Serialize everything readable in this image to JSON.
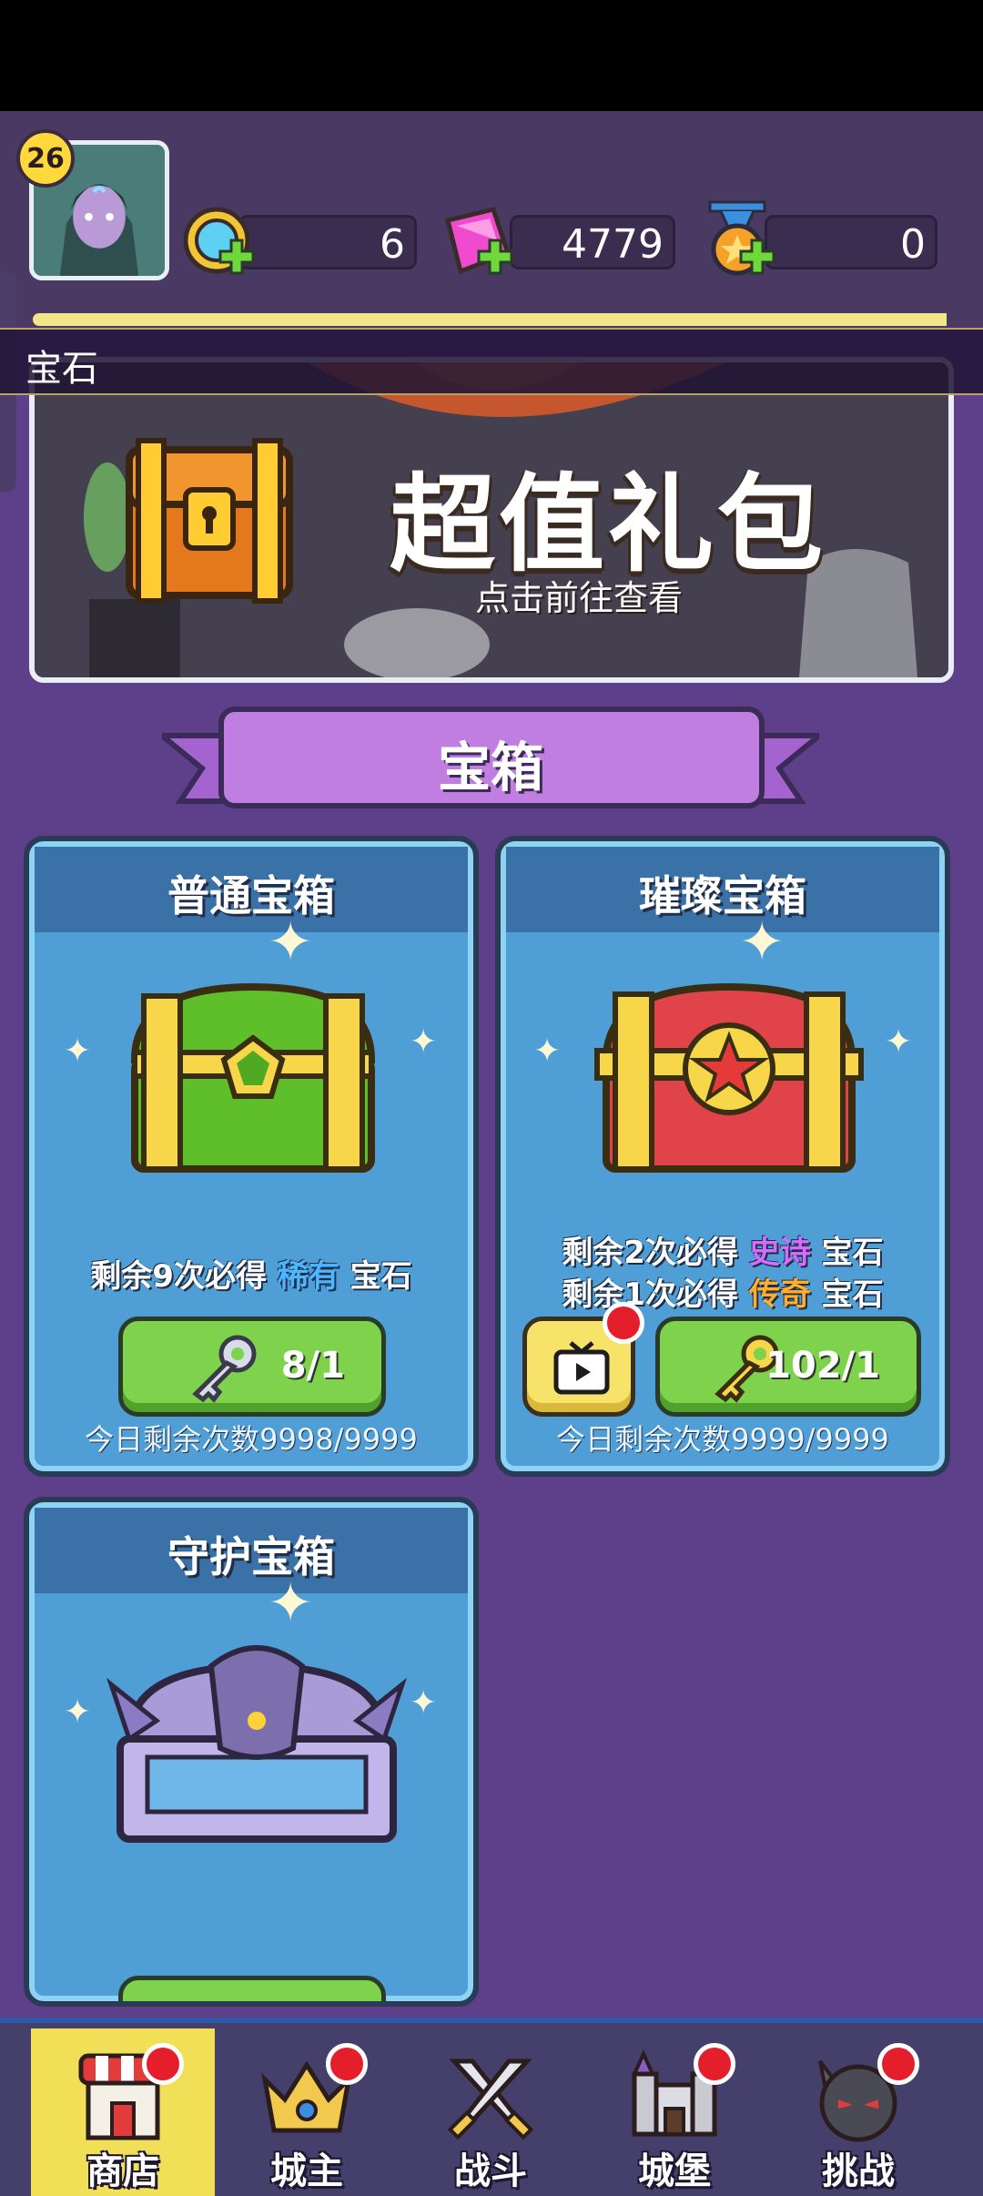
{
  "player": {
    "level": "26"
  },
  "resources": {
    "coins": "6",
    "gems": "4779",
    "medals": "0"
  },
  "strip_label": "宝石",
  "banner": {
    "title": "超值礼包",
    "subtitle": "点击前往查看"
  },
  "section_title": "宝箱",
  "chests": [
    {
      "name": "普通宝箱",
      "desc_prefix": "剩余9次必得",
      "desc_rarity": "稀有",
      "desc_suffix": "宝石",
      "key_count": "8/1",
      "remain": "今日剩余次数9998/9999"
    },
    {
      "name": "璀璨宝箱",
      "desc1_prefix": "剩余2次必得",
      "desc1_rarity": "史诗",
      "desc1_suffix": "宝石",
      "desc2_prefix": "剩余1次必得",
      "desc2_rarity": "传奇",
      "desc2_suffix": "宝石",
      "key_count": "102/1",
      "remain": "今日剩余次数9999/9999"
    },
    {
      "name": "守护宝箱"
    }
  ],
  "tabs": [
    {
      "label": "商店",
      "icon": "shop-icon"
    },
    {
      "label": "城主",
      "icon": "crown-icon"
    },
    {
      "label": "战斗",
      "icon": "swords-icon"
    },
    {
      "label": "城堡",
      "icon": "castle-icon"
    },
    {
      "label": "挑战",
      "icon": "demon-icon"
    }
  ],
  "colors": {
    "background": "#5e3f8a",
    "rare": "#4cb6ff",
    "epic": "#d56bff",
    "legendary": "#ffae2b",
    "active_tab": "#f2df58"
  }
}
